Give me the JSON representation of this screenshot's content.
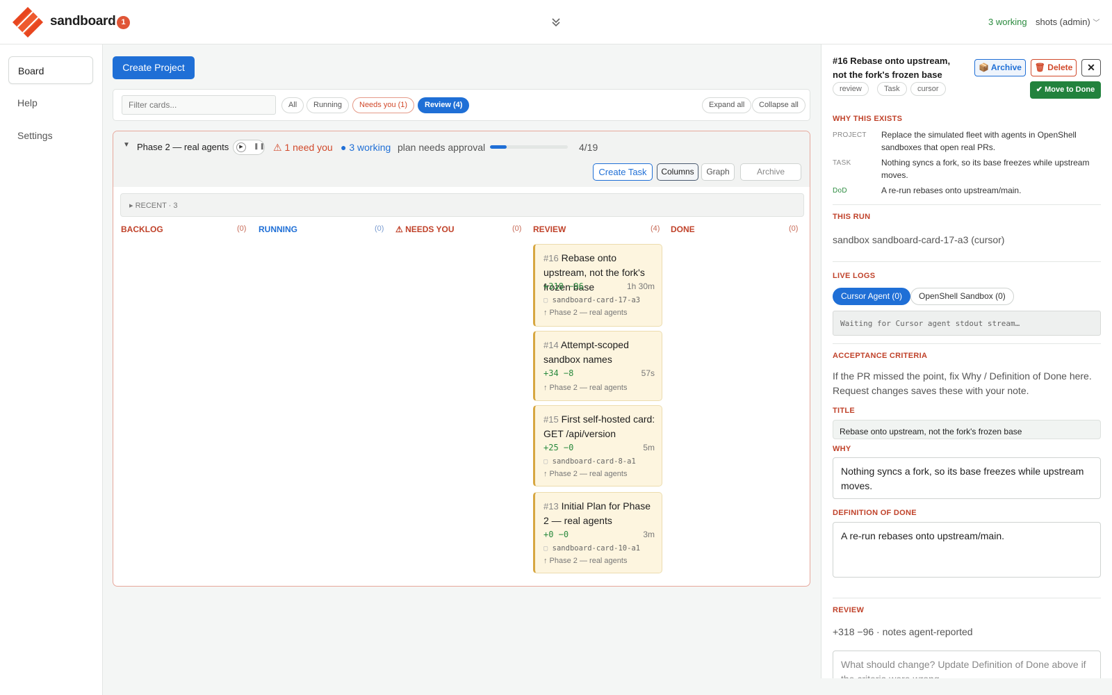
{
  "header": {
    "brand": "sandboard",
    "notifications": "1",
    "working": "3 working",
    "user": "shots (admin)"
  },
  "colors": {
    "accent": "#1f6fd6",
    "danger": "#d1492b",
    "success": "#22823d",
    "brand": "#e8461f"
  },
  "sidebar": {
    "items": [
      {
        "label": "Board"
      },
      {
        "label": "Help"
      },
      {
        "label": "Settings"
      }
    ]
  },
  "main": {
    "create_project": "Create Project",
    "filter_placeholder": "Filter cards...",
    "filters": [
      "All",
      "Running",
      "Needs you (1)",
      "Review (4)"
    ],
    "expand_all": "Expand all",
    "collapse_all": "Collapse all"
  },
  "project": {
    "name": "Phase 2 — real agents",
    "need_you": "⚠ 1 need you",
    "working": "● 3 working",
    "approval": "plan needs approval",
    "progress": 0.21,
    "count": "4/19",
    "create_task": "Create Task",
    "columns": "Columns",
    "graph": "Graph",
    "archive": "Archive",
    "recent": "▸ RECENT · 3"
  },
  "columns": [
    {
      "title": "BACKLOG",
      "count": "(0)",
      "color": "#c0422a"
    },
    {
      "title": "RUNNING",
      "count": "(0)",
      "color": "#1f6fd6"
    },
    {
      "title": "⚠ NEEDS YOU",
      "count": "(0)",
      "color": "#c0422a"
    },
    {
      "title": "REVIEW",
      "count": "(4)",
      "color": "#c0422a"
    },
    {
      "title": "DONE",
      "count": "(0)",
      "color": "#c0422a"
    }
  ],
  "cards": [
    {
      "num": "#16",
      "title": "Rebase onto upstream, not the fork's frozen base",
      "diff": "+318 −96",
      "dur": "1h 30m",
      "sandbox": "sandboard-card-17-a3",
      "phase": "↑ Phase 2 — real agents"
    },
    {
      "num": "#14",
      "title": "Attempt-scoped sandbox names",
      "diff": "+34 −8",
      "dur": "57s",
      "sandbox": "",
      "phase": "↑ Phase 2 — real agents"
    },
    {
      "num": "#15",
      "title": "First self-hosted card: GET /api/version",
      "diff": "+25 −0",
      "dur": "5m",
      "sandbox": "sandboard-card-8-a1",
      "phase": "↑ Phase 2 — real agents"
    },
    {
      "num": "#13",
      "title": "Initial Plan for Phase 2 — real agents",
      "diff": "+0 −0",
      "dur": "3m",
      "sandbox": "sandboard-card-10-a1",
      "phase": "↑ Phase 2 — real agents"
    }
  ],
  "panel": {
    "title": "#16 Rebase onto upstream, not the fork's frozen base",
    "tags": [
      "review",
      "Task",
      "cursor"
    ],
    "archive": "📦 Archive",
    "delete": "🗑 Delete",
    "close": "✕",
    "move_done": "✔ Move to Done",
    "why_heading": "WHY THIS EXISTS",
    "project_key": "PROJECT",
    "project_val": "Replace the simulated fleet with agents in OpenShell sandboxes that open real PRs.",
    "task_key": "TASK",
    "task_val": "Nothing syncs a fork, so its base freezes while upstream moves.",
    "dod_key": "DoD",
    "dod_val": "A re-run rebases onto upstream/main.",
    "run_heading": "THIS RUN",
    "run_val": "sandbox sandboard-card-17-a3 (cursor)",
    "logs_heading": "LIVE LOGS",
    "tab_cursor": "Cursor Agent (0)",
    "tab_openshell": "OpenShell Sandbox (0)",
    "log_text": "Waiting for Cursor agent stdout stream…",
    "acc_heading": "ACCEPTANCE CRITERIA",
    "acc_text": "If the PR missed the point, fix Why / Definition of Done here. Request changes saves these with your note.",
    "title_label": "TITLE",
    "title_value": "Rebase onto upstream, not the fork's frozen base",
    "why_label": "WHY",
    "why_value": "Nothing syncs a fork, so its base freezes while upstream moves.",
    "dod_label": "DEFINITION OF DONE",
    "dod_value": "A re-run rebases onto upstream/main.",
    "review_heading": "REVIEW",
    "review_meta": "+318 −96 · notes agent-reported",
    "review_placeholder": "What should change? Update Definition of Done above if the criteria were wrong."
  }
}
